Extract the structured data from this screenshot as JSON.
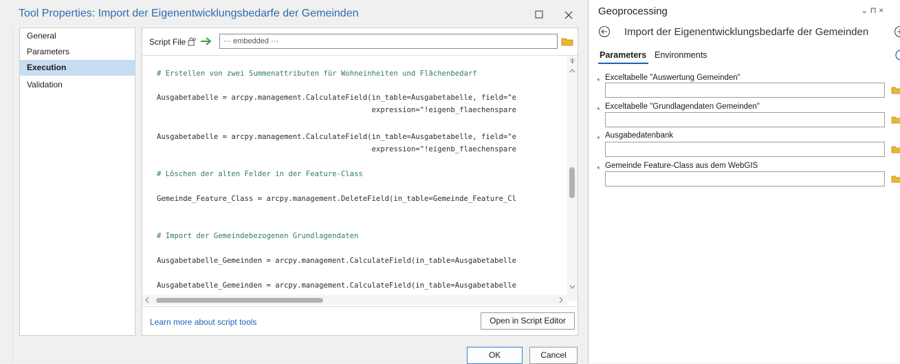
{
  "dialog": {
    "title": "Tool Properties: Import der Eigenentwicklungsbedarfe der Gemeinden",
    "nav": [
      {
        "label": "General",
        "selected": false
      },
      {
        "label": "Parameters",
        "selected": false
      },
      {
        "label": "Execution",
        "selected": true
      },
      {
        "label": "Validation",
        "selected": false
      }
    ],
    "script_file_label": "Script File",
    "script_file_value": "··· embedded ···",
    "code_lines": [
      {
        "text": "# Erstellen von zwei Summenattributen für Wohneinheiten und Flächenbedarf",
        "kind": "comment"
      },
      {
        "text": "Ausgabetabelle = arcpy.management.CalculateField(in_table=Ausgabetabelle, field=\"e",
        "kind": "code"
      },
      {
        "text": "                                                 expression=\"!eigenb_flaechenspare",
        "kind": "code"
      },
      {
        "text": "Ausgabetabelle = arcpy.management.CalculateField(in_table=Ausgabetabelle, field=\"e",
        "kind": "code"
      },
      {
        "text": "                                                 expression=\"!eigenb_flaechenspare",
        "kind": "code"
      },
      {
        "text": "# Löschen der alten Felder in der Feature-Class",
        "kind": "comment"
      },
      {
        "text": "Gemeinde_Feature_Class = arcpy.management.DeleteField(in_table=Gemeinde_Feature_Cl",
        "kind": "code"
      },
      {
        "text": "# Import der Gemeindebezogenen Grundlagendaten",
        "kind": "comment"
      },
      {
        "text": "Ausgabetabelle_Gemeinden = arcpy.management.CalculateField(in_table=Ausgabetabelle",
        "kind": "code"
      },
      {
        "text": "Ausgabetabelle_Gemeinden = arcpy.management.CalculateField(in_table=Ausgabetabelle",
        "kind": "code"
      }
    ],
    "learn_more": "Learn more about script tools",
    "open_editor": "Open in Script Editor",
    "ok": "OK",
    "cancel": "Cancel"
  },
  "geoprocessing": {
    "pane_title": "Geoprocessing",
    "pane_controls": "⌄  ⊓  ×",
    "tool_title": "Import der Eigenentwicklungsbedarfe der Gemeinden",
    "tabs": [
      "Parameters",
      "Environments"
    ],
    "required_marker": "*",
    "params": [
      {
        "label": "Exceltabelle \"Auswertung Gemeinden\"",
        "value": ""
      },
      {
        "label": "Exceltabelle \"Grundlagendaten Gemeinden\"",
        "value": ""
      },
      {
        "label": "Ausgabedatenbank",
        "value": ""
      },
      {
        "label": "Gemeinde Feature-Class aus dem WebGIS",
        "value": ""
      }
    ]
  },
  "colors": {
    "accent": "#1a5fb4",
    "title_blue": "#2b6cb0",
    "selection": "#c8ddf2",
    "required": "#d03a3a",
    "comment": "#2e7d5b"
  }
}
